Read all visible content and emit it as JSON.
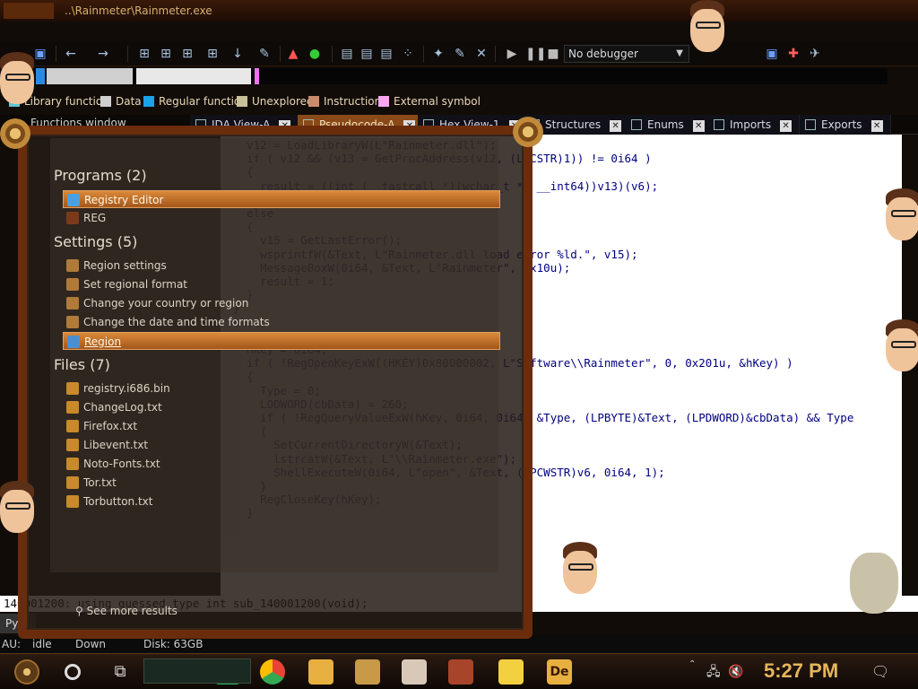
{
  "ida": {
    "title": "..\\Rainmeter\\Rainmeter.exe",
    "debugger": "No debugger"
  },
  "legend": [
    {
      "label": "Library function",
      "color": "#5fc6d8"
    },
    {
      "label": "Data",
      "color": "#cfcfcf"
    },
    {
      "label": "Regular function",
      "color": "#1aa3e8"
    },
    {
      "label": "Unexplored",
      "color": "#c8c098"
    },
    {
      "label": "Instruction",
      "color": "#c98d6c"
    },
    {
      "label": "External symbol",
      "color": "#f5a8f0"
    }
  ],
  "functions_window_title": "Functions window",
  "tabs": [
    {
      "label": "IDA View-A",
      "active": false
    },
    {
      "label": "Pseudocode-A",
      "active": true
    },
    {
      "label": "Hex View-1",
      "active": false
    },
    {
      "label": "Structures",
      "active": false
    },
    {
      "label": "Enums",
      "active": false
    },
    {
      "label": "Imports",
      "active": false
    },
    {
      "label": "Exports",
      "active": false
    }
  ],
  "code_lines": [
    "  v12 = LoadLibraryW(L\"Rainmeter.dll\");",
    "  if ( v12 && (v13 = GetProcAddress(v12, (LPCSTR)1)) != 0i64 )",
    "  {",
    "    result = ((int (__fastcall *)(wchar_t *, __int64))v13)(v6);",
    "  }",
    "  else",
    "  {",
    "    v15 = GetLastError();",
    "    wsprintfW(&Text, L\"Rainmeter.dll load error %ld.\", v15);",
    "    MessageBoxW(0i64, &Text, L\"Rainmeter\", 0x10u);",
    "    result = 1;",
    "  }",
    "}",
    "else",
    "{",
    "  hKey = 0i64;",
    "  if ( !RegOpenKeyExW((HKEY)0x80000002, L\"Software\\\\Rainmeter\", 0, 0x201u, &hKey) )",
    "  {",
    "    Type = 0;",
    "    LODWORD(cbData) = 260;",
    "    if ( !RegQueryValueExW(hKey, 0i64, 0i64, &Type, (LPBYTE)&Text, (LPDWORD)&cbData) && Type",
    "    {",
    "      SetCurrentDirectoryW(&Text);",
    "      lstrcatW(&Text, L\"\\\\Rainmeter.exe\");",
    "      ShellExecuteW(0i64, L\"open\", &Text, (LPCWSTR)v6, 0i64, 1);",
    "    }",
    "    RegCloseKey(hKey);",
    "  }"
  ],
  "output_line": "140001200: using guessed type int sub_140001200(void);",
  "python_tab": "Py",
  "status": {
    "au": "AU:",
    "au_state": "idle",
    "direction": "Down",
    "disk": "Disk: 63GB"
  },
  "start_menu": {
    "groups": [
      {
        "title": "Programs (2)",
        "items": [
          {
            "label": "Registry Editor",
            "selected": true,
            "icon_color": "#4aa0e0"
          },
          {
            "label": "REG",
            "selected": false,
            "icon_color": "#7a3a1a"
          }
        ]
      },
      {
        "title": "Settings (5)",
        "items": [
          {
            "label": "Region settings",
            "selected": false,
            "icon_color": "#b07a3a"
          },
          {
            "label": "Set regional format",
            "selected": false,
            "icon_color": "#b07a3a"
          },
          {
            "label": "Change your country or region",
            "selected": false,
            "icon_color": "#b07a3a"
          },
          {
            "label": "Change the date and time formats",
            "selected": false,
            "icon_color": "#b07a3a"
          },
          {
            "label": "Region",
            "selected": true,
            "icon_color": "#4a90d0",
            "link": true
          }
        ]
      },
      {
        "title": "Files (7)",
        "items": [
          {
            "label": "registry.i686.bin",
            "selected": false,
            "icon_color": "#c88a2a"
          },
          {
            "label": "ChangeLog.txt",
            "selected": false,
            "icon_color": "#c88a2a"
          },
          {
            "label": "Firefox.txt",
            "selected": false,
            "icon_color": "#c88a2a"
          },
          {
            "label": "Libevent.txt",
            "selected": false,
            "icon_color": "#c88a2a"
          },
          {
            "label": "Noto-Fonts.txt",
            "selected": false,
            "icon_color": "#c88a2a"
          },
          {
            "label": "Tor.txt",
            "selected": false,
            "icon_color": "#c88a2a"
          },
          {
            "label": "Torbutton.txt",
            "selected": false,
            "icon_color": "#c88a2a"
          }
        ]
      }
    ],
    "see_more": "See more results"
  },
  "taskbar": {
    "clock": "5:27 PM",
    "apps": [
      "chrome-icon",
      "file-explorer-icon",
      "app-icon",
      "profile-icon",
      "media-icon",
      "sticky-notes-icon",
      "adobe-icon"
    ]
  }
}
